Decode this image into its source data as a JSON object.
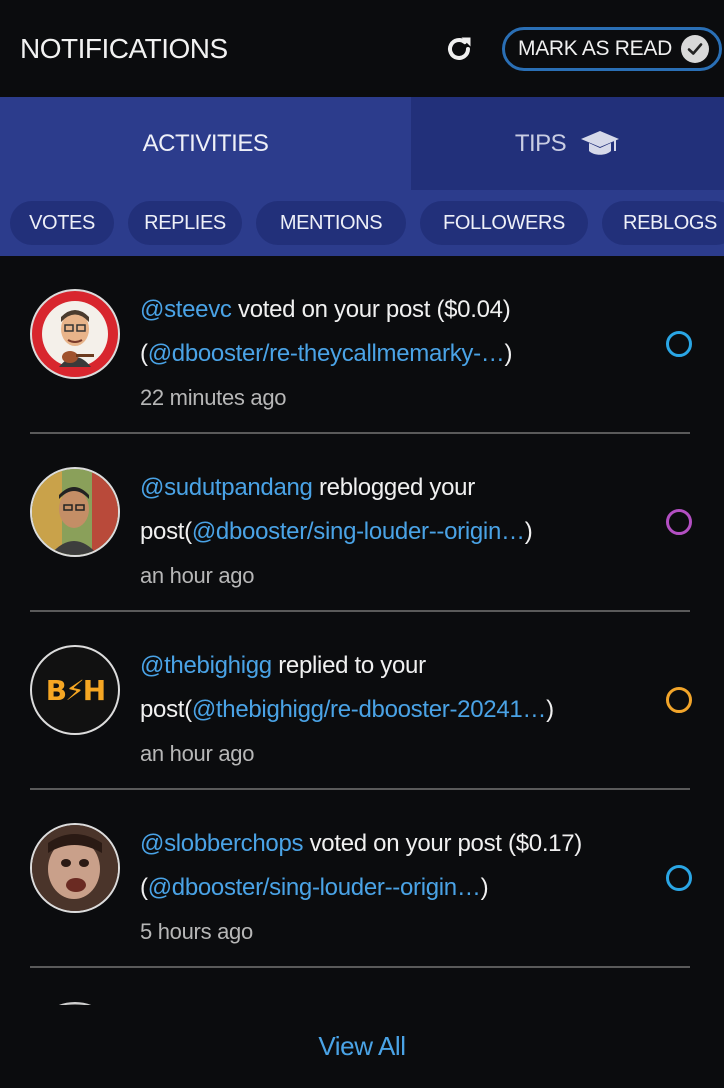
{
  "header": {
    "title": "NOTIFICATIONS",
    "mark_read_label": "MARK AS READ"
  },
  "tabs": [
    {
      "label": "ACTIVITIES",
      "active": true
    },
    {
      "label": "TIPS",
      "icon": "graduation-cap-icon",
      "active": false
    }
  ],
  "filters": [
    "VOTES",
    "REPLIES",
    "MENTIONS",
    "FOLLOWERS",
    "REBLOGS"
  ],
  "notifications": [
    {
      "user": "@steevc",
      "action": " voted on your post ($0.04)",
      "link_prefix": "(",
      "link": "@dbooster/re-theycallmemarky-…",
      "link_suffix": ")",
      "time": "22 minutes ago",
      "status_color": "#2aa6e5"
    },
    {
      "user": "@sudutpandang",
      "action": " reblogged your",
      "link_prefix": "post(",
      "link": "@dbooster/sing-louder--origin…",
      "link_suffix": ")",
      "time": "an hour ago",
      "status_color": "#b34fc2"
    },
    {
      "user": "@thebighigg",
      "action": " replied to your",
      "link_prefix": "post(",
      "link": "@thebighigg/re-dbooster-20241…",
      "link_suffix": ")",
      "time": "an hour ago",
      "status_color": "#f2a52a",
      "avatar_text": "B⚡H"
    },
    {
      "user": "@slobberchops",
      "action": " voted on your post ($0.17)",
      "link_prefix": "(",
      "link": "@dbooster/sing-louder--origin…",
      "link_suffix": ")",
      "time": "5 hours ago",
      "status_color": "#2aa6e5"
    }
  ],
  "footer": {
    "view_all": "View All"
  },
  "colors": {
    "accent": "#4aa3e6",
    "tab_bar": "#2c3c8c",
    "chip": "#22307a"
  }
}
